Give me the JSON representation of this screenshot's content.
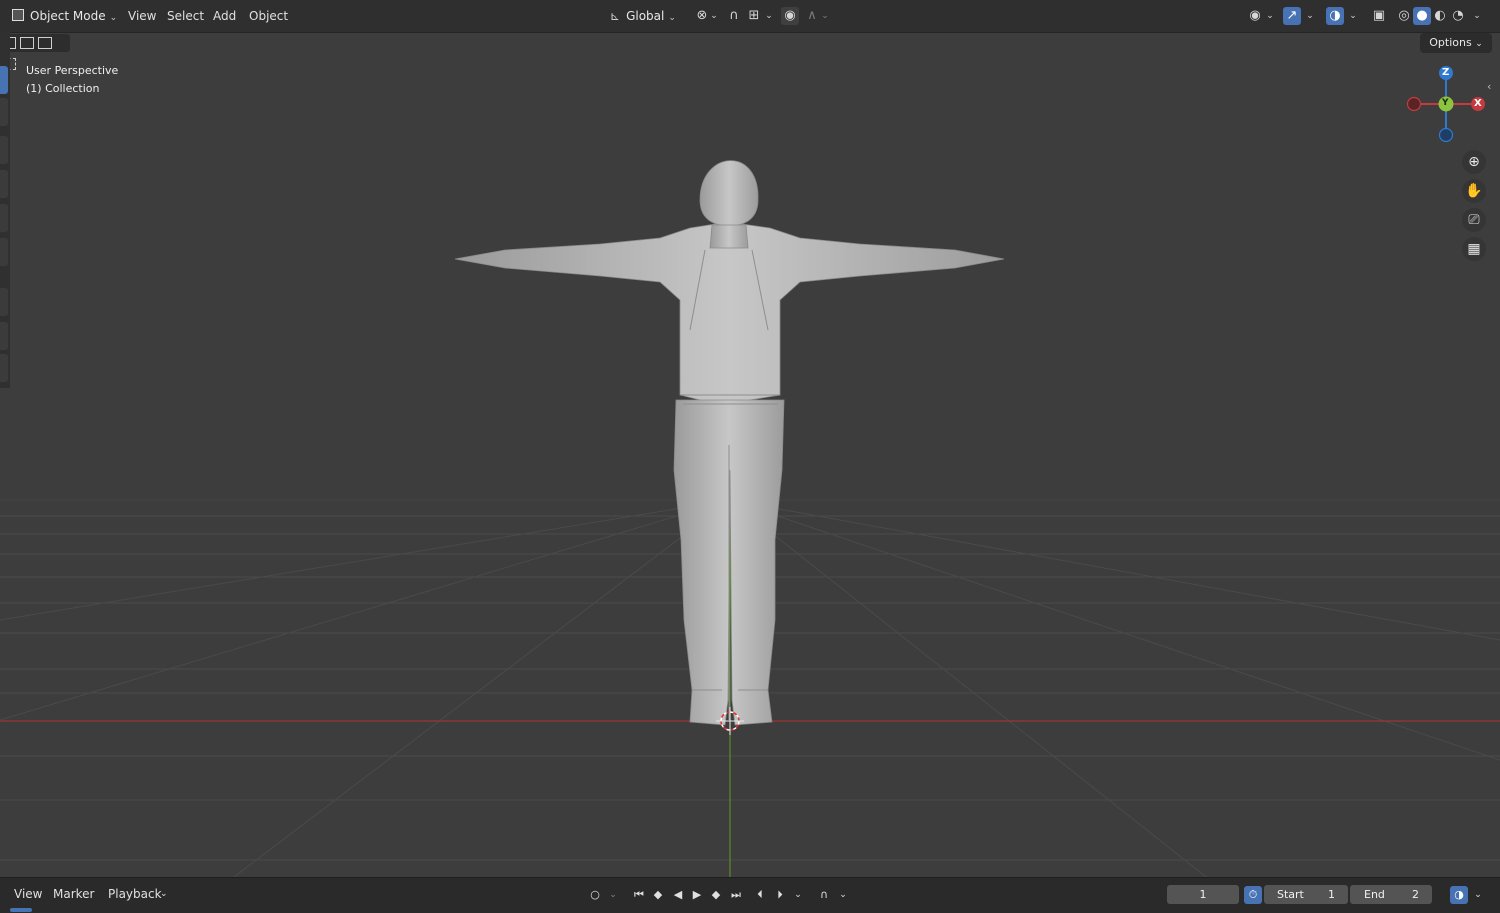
{
  "header": {
    "mode_label": "Object Mode",
    "menu": [
      "View",
      "Select",
      "Add",
      "Object"
    ],
    "transform_orientation": "Global"
  },
  "viewport": {
    "info_line1": "User Perspective",
    "info_line2": "(1) Collection",
    "options_label": "Options",
    "gizmo": {
      "z": "Z",
      "y": "Y",
      "x": "X"
    }
  },
  "timeline": {
    "menu": [
      "View",
      "Marker",
      "Playback"
    ],
    "current_frame": "1",
    "start_label": "Start",
    "start_value": "1",
    "end_label": "End",
    "end_value": "2"
  },
  "colors": {
    "axis_x": "#c53a3e",
    "axis_y": "#6a9a2a",
    "axis_z": "#2f7ad0",
    "accent": "#4772b3"
  }
}
